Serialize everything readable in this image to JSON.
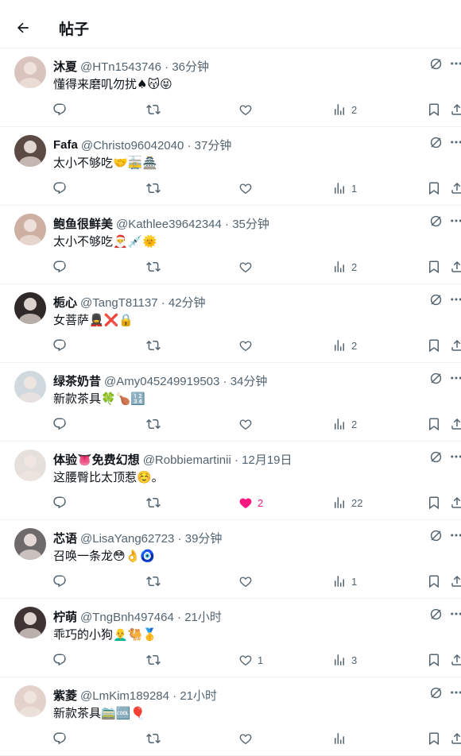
{
  "header": {
    "title": "帖子"
  },
  "posts": [
    {
      "name": "沐夏",
      "handle": "@HTn1543746",
      "time": "36分钟",
      "text": "懂得来磨叽勿扰♠😽😝",
      "avatar_color": "#d9c4bd",
      "views": "2",
      "likes": "",
      "liked": false
    },
    {
      "name": "Fafa",
      "handle": "@Christo96042040",
      "time": "37分钟",
      "text": "太小不够吃🤝🚋🏯",
      "avatar_color": "#5a4a43",
      "views": "1",
      "likes": "",
      "liked": false
    },
    {
      "name": "鲍鱼很鲜美",
      "handle": "@Kathlee39642344",
      "time": "35分钟",
      "text": "太小不够吃🎅💉🌞",
      "avatar_color": "#cdb0a2",
      "views": "2",
      "likes": "",
      "liked": false
    },
    {
      "name": "栀心",
      "handle": "@TangT81137",
      "time": "42分钟",
      "text": "女菩萨💂‍♀️❌🔒",
      "avatar_color": "#2f2a29",
      "views": "2",
      "likes": "",
      "liked": false
    },
    {
      "name": "绿茶奶昔",
      "handle": "@Amy045249919503",
      "time": "34分钟",
      "text": "新款茶具🍀🍗🔢",
      "avatar_color": "#cfd9de",
      "views": "2",
      "likes": "",
      "liked": false
    },
    {
      "name": "体验👅免费幻想",
      "handle": "@Robbiemartinii",
      "time": "12月19日",
      "text": "这腰臀比太顶惹☺️。",
      "avatar_color": "#e6e0dc",
      "views": "22",
      "likes": "2",
      "liked": true
    },
    {
      "name": "芯语",
      "handle": "@LisaYang62723",
      "time": "39分钟",
      "text": "召唤一条龙😳👌🧿",
      "avatar_color": "#6e6a6b",
      "views": "1",
      "likes": "",
      "liked": false
    },
    {
      "name": "柠萌",
      "handle": "@TngBnh497464",
      "time": "21小时",
      "text": "乖巧的小狗👨‍🦲🐫🥇",
      "avatar_color": "#3f3433",
      "views": "3",
      "likes": "1",
      "liked": false
    },
    {
      "name": "紫菱",
      "handle": "@LmKim189284",
      "time": "21小时",
      "text": "新款茶具🚞🆒🎈",
      "avatar_color": "#e2d2cb",
      "views": "",
      "likes": "",
      "liked": false
    }
  ],
  "icons": {
    "back": "arrow-left-icon",
    "reply": "reply-icon",
    "repost": "repost-icon",
    "like": "heart-icon",
    "views": "views-icon",
    "bookmark": "bookmark-icon",
    "share": "share-icon",
    "grok": "grok-icon",
    "more": "more-icon"
  },
  "colors": {
    "liked": "#f91880",
    "secondary": "#536471"
  }
}
